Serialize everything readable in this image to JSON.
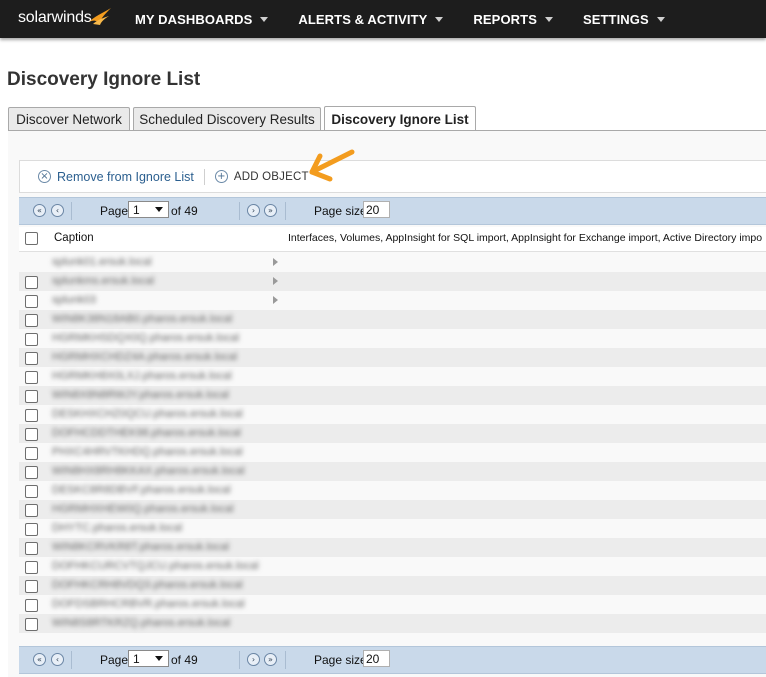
{
  "nav": {
    "logo_text": "solarwinds",
    "items": [
      {
        "label": "MY DASHBOARDS"
      },
      {
        "label": "ALERTS & ACTIVITY"
      },
      {
        "label": "REPORTS"
      },
      {
        "label": "SETTINGS"
      }
    ]
  },
  "page": {
    "title": "Discovery Ignore List"
  },
  "tabs": [
    {
      "label": "Discover Network"
    },
    {
      "label": "Scheduled Discovery Results"
    },
    {
      "label": "Discovery Ignore List",
      "active": true
    }
  ],
  "toolbar": {
    "remove_label": "Remove from Ignore List",
    "add_label": "ADD OBJECT"
  },
  "pager": {
    "page_label": "Page",
    "current_page": "1",
    "of_label": "of 49",
    "page_size_label": "Page size",
    "page_size": "20"
  },
  "grid": {
    "columns": {
      "caption": "Caption",
      "types": "Interfaces, Volumes, AppInsight for SQL import, AppInsight for Exchange import, Active Directory impo"
    },
    "rows": [
      {
        "caption": "splunk01.ersuk.local",
        "checkbox": false,
        "expandable": true
      },
      {
        "caption": "splunkms.ersuk.local",
        "checkbox": true,
        "expandable": true
      },
      {
        "caption": "splunk03",
        "checkbox": true,
        "expandable": true
      },
      {
        "caption": "WIN8K38N18AB0.pharos.ersuk.local",
        "checkbox": true,
        "expandable": false
      },
      {
        "caption": "HGRMKHSDQX0Q.pharos.ersuk.local",
        "checkbox": true,
        "expandable": false
      },
      {
        "caption": "HGRMHXCHDZ4A.pharos.ersuk.local",
        "checkbox": true,
        "expandable": false
      },
      {
        "caption": "HGRMKH8X0LXJ.pharos.ersuk.local",
        "checkbox": true,
        "expandable": false
      },
      {
        "caption": "WIN8X8N8RWJY.pharos.ersuk.local",
        "checkbox": true,
        "expandable": false
      },
      {
        "caption": "DESKHXCHZ0QCU.pharos.ersuk.local",
        "checkbox": true,
        "expandable": false
      },
      {
        "caption": "DOFHCDDTHEK98.pharos.ersuk.local",
        "checkbox": true,
        "expandable": false
      },
      {
        "caption": "PHXC4HRVTKHDQ.pharos.ersuk.local",
        "checkbox": true,
        "expandable": false
      },
      {
        "caption": "WIN8HX8RH8KKAX.pharos.ersuk.local",
        "checkbox": true,
        "expandable": false
      },
      {
        "caption": "DESKC8R8DBVF.pharos.ersuk.local",
        "checkbox": true,
        "expandable": false
      },
      {
        "caption": "HGRMHXHEW0Q.pharos.ersuk.local",
        "checkbox": true,
        "expandable": false
      },
      {
        "caption": "DHYTC.pharos.ersuk.local",
        "checkbox": true,
        "expandable": false
      },
      {
        "caption": "WIN8KCRVKR8T.pharos.ersuk.local",
        "checkbox": true,
        "expandable": false
      },
      {
        "caption": "DOFHKCURCVTQJCU.pharos.ersuk.local",
        "checkbox": true,
        "expandable": false
      },
      {
        "caption": "DOFHKCRH8VDQ3.pharos.ersuk.local",
        "checkbox": true,
        "expandable": false
      },
      {
        "caption": "DOFDSBRHCRBVR.pharos.ersuk.local",
        "checkbox": true,
        "expandable": false
      },
      {
        "caption": "WIN8S8RTKRZQ.pharos.ersuk.local",
        "checkbox": true,
        "expandable": false
      }
    ]
  },
  "colors": {
    "nav_bg": "#1d1d1d",
    "pager_bg": "#c9d9ea",
    "link_blue": "#2b5f8f",
    "accent_orange": "#f39c1e"
  }
}
